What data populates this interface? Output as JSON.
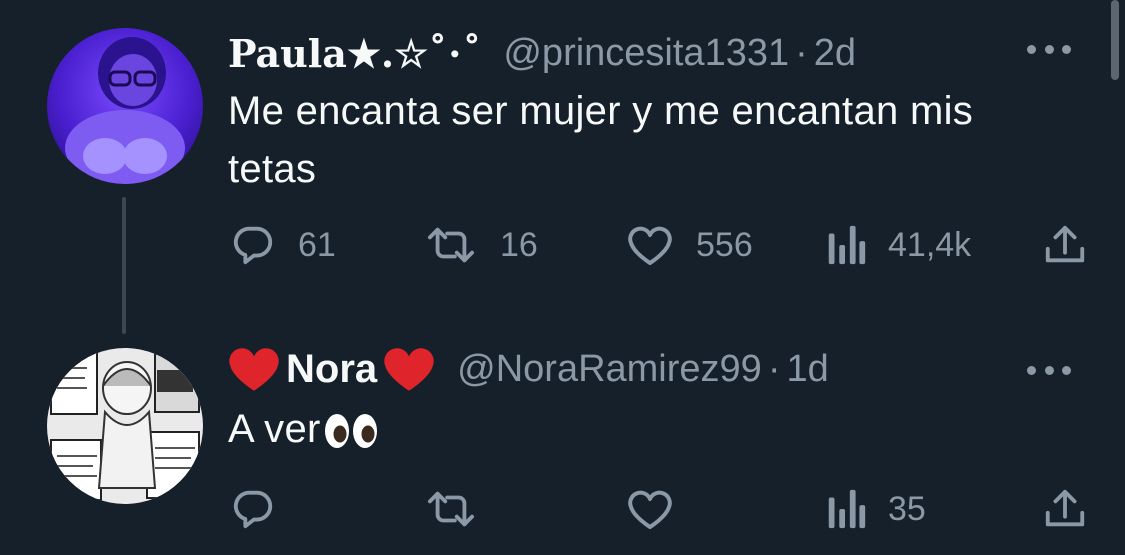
{
  "tweets": [
    {
      "display_name": "Paula★.☆˚⋅˚",
      "handle": "@princesita1331",
      "separator": "·",
      "time": "2d",
      "text": "Me encanta ser mujer y me encantan mis tetas",
      "text_line1": "Me encanta ser mujer y me encantan mis",
      "text_line2": "tetas",
      "replies": "61",
      "retweets": "16",
      "likes": "556",
      "views": "41,4k"
    },
    {
      "display_name": "Nora",
      "handle": "@NoraRamirez99",
      "separator": "·",
      "time": "1d",
      "text": "A ver",
      "replies": "",
      "retweets": "",
      "likes": "",
      "views": "35"
    }
  ],
  "icons": {
    "reply": "reply-icon",
    "retweet": "retweet-icon",
    "like": "heart-icon",
    "views": "views-icon",
    "share": "share-icon",
    "more": "more-icon"
  },
  "colors": {
    "background": "#15202b",
    "text_primary": "#f7f9f9",
    "text_secondary": "#8b98a5",
    "thread_line": "#3b4753",
    "heart_emoji": "#e0242c"
  }
}
